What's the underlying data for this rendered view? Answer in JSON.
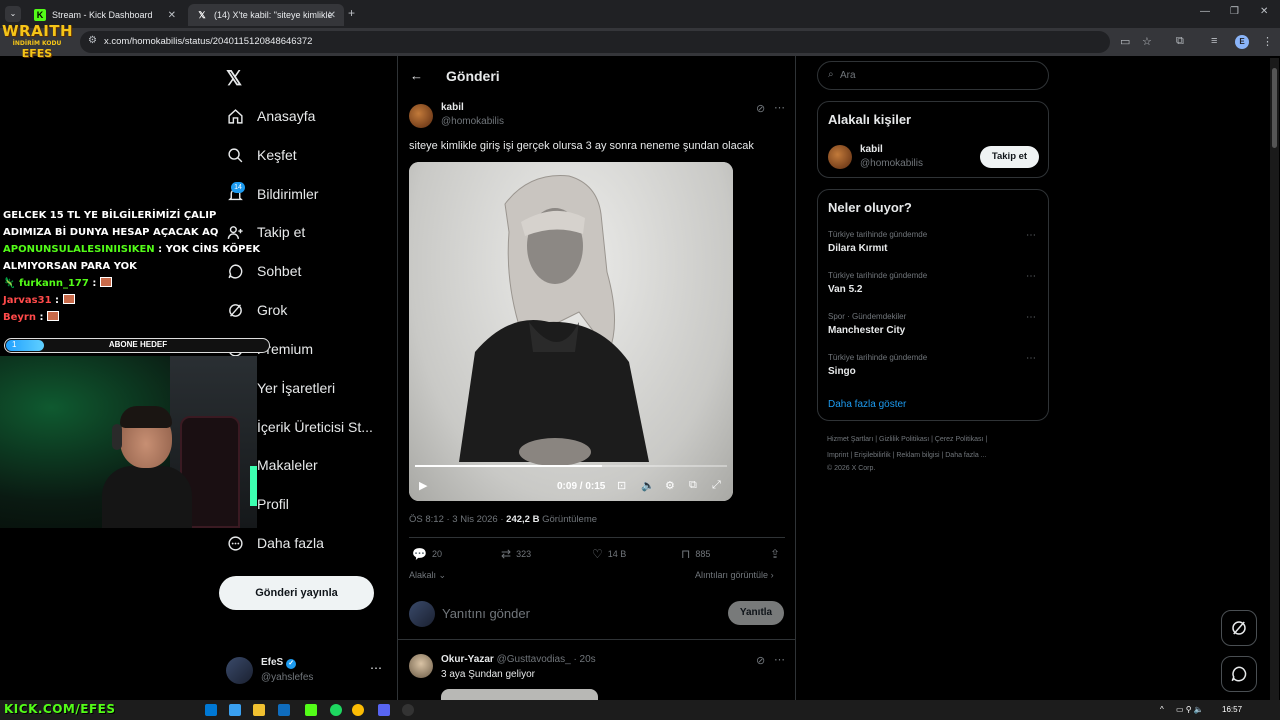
{
  "browser": {
    "tabs": [
      {
        "title": "Stream - Kick Dashboard",
        "icon": "kick-icon"
      },
      {
        "title": "(14) X'te kabil: \"siteye kimlikle g",
        "icon": "x-icon"
      }
    ],
    "url": "x.com/homokabilis/status/2040115120848646372",
    "profile_initial": "E"
  },
  "overlay": {
    "logo_line1": "WRAITH",
    "logo_line2": "İNDİRİM KODU",
    "logo_line3": "EFES",
    "chat": [
      {
        "user": "",
        "text": "GELCEK 15 TL YE BİLGİLERİMİZİ ÇALIP ADIMIZA Bİ DUNYA HESAP AÇACAK AQ"
      },
      {
        "user": "APONUNSULALESINIISIKEN",
        "text": "YOK CİNS KÖPEK ALMIYORSAN PARA YOK",
        "color": "#53fc18"
      },
      {
        "user": "furkann_177",
        "text": "",
        "color": "#53fc18"
      },
      {
        "user": "Jarvas31",
        "text": "",
        "color": "#ff4a4a"
      },
      {
        "user": "Beyrn",
        "text": "",
        "color": "#ff4a4a"
      }
    ],
    "sub_goal_label": "ABONE HEDEF",
    "sub_goal_count": "1",
    "sub_goal_progress": 0.145,
    "kick_url": "KICK.COM/EFES"
  },
  "nav": {
    "items": [
      {
        "label": "Anasayfa",
        "icon": "home-icon"
      },
      {
        "label": "Keşfet",
        "icon": "search-icon"
      },
      {
        "label": "Bildirimler",
        "icon": "bell-icon"
      },
      {
        "label": "Takip et",
        "icon": "add-user-icon"
      },
      {
        "label": "Sohbet",
        "icon": "chat-icon"
      },
      {
        "label": "Grok",
        "icon": "grok-icon"
      },
      {
        "label": "Premium",
        "icon": "premium-icon"
      },
      {
        "label": "Yer İşaretleri",
        "icon": "bookmark-icon"
      },
      {
        "label": "İçerik Üreticisi St...",
        "icon": "creator-icon"
      },
      {
        "label": "Makaleler",
        "icon": "article-icon"
      },
      {
        "label": "Profil",
        "icon": "profile-icon"
      },
      {
        "label": "Daha fazla",
        "icon": "more-icon"
      }
    ],
    "notifications_badge": "14",
    "post_button": "Gönderi yayınla",
    "account": {
      "name": "EfeS",
      "handle": "@yahslefes"
    }
  },
  "main": {
    "header_title": "Gönderi",
    "tweet": {
      "name": "kabil",
      "handle": "@homokabilis",
      "text": "siteye kimlikle giriş işi gerçek olursa 3 ay sonra neneme şundan olacak",
      "video_time": "0:09 / 0:15",
      "video_progress": 0.6,
      "timestamp": "ÖS 8:12 · 3 Nis 2026 · ",
      "views_count": "242,2 B",
      "views_label": " Görüntüleme",
      "replies": "20",
      "reposts": "323",
      "likes": "14 B",
      "bookmarks": "885",
      "sort_label": "Alakalı",
      "quotes_link": "Alıntıları görüntüle"
    },
    "reply_placeholder": "Yanıtını gönder",
    "reply_button": "Yanıtla",
    "reply": {
      "name": "Okur-Yazar",
      "handle": "@Gusttavodias_ · 20s",
      "text": "3 aya Şundan geliyor"
    }
  },
  "sidebar": {
    "search_placeholder": "Ara",
    "relevant_title": "Alakalı kişiler",
    "relevant_person": {
      "name": "kabil",
      "handle": "@homokabilis",
      "follow_label": "Takip et"
    },
    "trends_title": "Neler oluyor?",
    "trends": [
      {
        "context": "Türkiye tarihinde gündemde",
        "name": "Dilara Kırmıt"
      },
      {
        "context": "Türkiye tarihinde gündemde",
        "name": "Van 5.2"
      },
      {
        "context": "Spor · Gündemdekiler",
        "name": "Manchester City"
      },
      {
        "context": "Türkiye tarihinde gündemde",
        "name": "Singo"
      }
    ],
    "show_more": "Daha fazla göster",
    "footer_line1": "Hizmet Şartları  |  Gizlilik Politikası  |  Çerez Politikası  |",
    "footer_line2": "Imprint  |  Erişilebilirlik  |  Reklam bilgisi  |  Daha fazla ...",
    "footer_line3": "© 2026 X Corp."
  },
  "taskbar": {
    "time": "16:57"
  }
}
